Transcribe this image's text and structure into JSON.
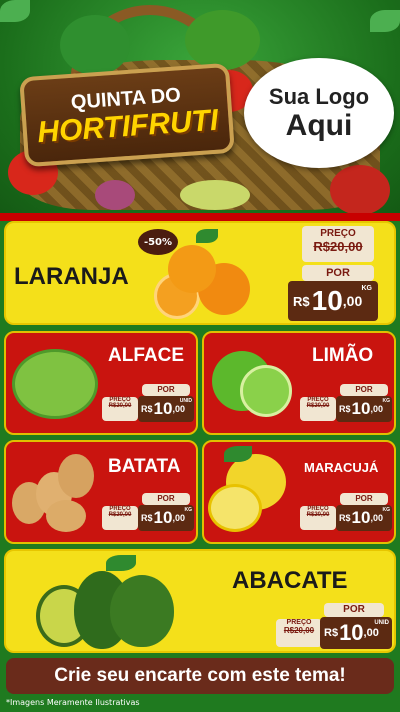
{
  "header": {
    "title_top": "QUINTA DO",
    "title_main": "HORTIFRUTI",
    "logo_line1": "Sua Logo",
    "logo_line2": "Aqui"
  },
  "labels": {
    "preco": "PREÇO",
    "por": "POR",
    "currency": "R$"
  },
  "products": {
    "laranja": {
      "name": "LARANJA",
      "discount": "-50%",
      "old_price": "R$20,00",
      "price_int": "10",
      "price_dec": ",00",
      "unit": "KG"
    },
    "alface": {
      "name": "ALFACE",
      "old_price": "R$20,00",
      "price_int": "10",
      "price_dec": ",00",
      "unit": "UNID"
    },
    "limao": {
      "name": "LIMÃO",
      "old_price": "R$20,00",
      "price_int": "10",
      "price_dec": ",00",
      "unit": "KG"
    },
    "batata": {
      "name": "BATATA",
      "old_price": "R$20,00",
      "price_int": "10",
      "price_dec": ",00",
      "unit": "KG"
    },
    "maracuja": {
      "name": "MARACUJÁ",
      "old_price": "R$20,00",
      "price_int": "10",
      "price_dec": ",00",
      "unit": "KG"
    },
    "abacate": {
      "name": "ABACATE",
      "old_price": "R$20,00",
      "price_int": "10",
      "price_dec": ",00",
      "unit": "UNID"
    }
  },
  "cta": "Crie seu encarte com este tema!",
  "disclaimer": "*Imagens Meramente Ilustrativas",
  "colors": {
    "green": "#1f7a1f",
    "yellow": "#f4e01a",
    "red": "#c9140f",
    "brown": "#5c2a12"
  },
  "icons": [
    "orange-icon",
    "lettuce-icon",
    "lime-icon",
    "potato-icon",
    "passion-fruit-icon",
    "avocado-icon",
    "basket-icon"
  ]
}
